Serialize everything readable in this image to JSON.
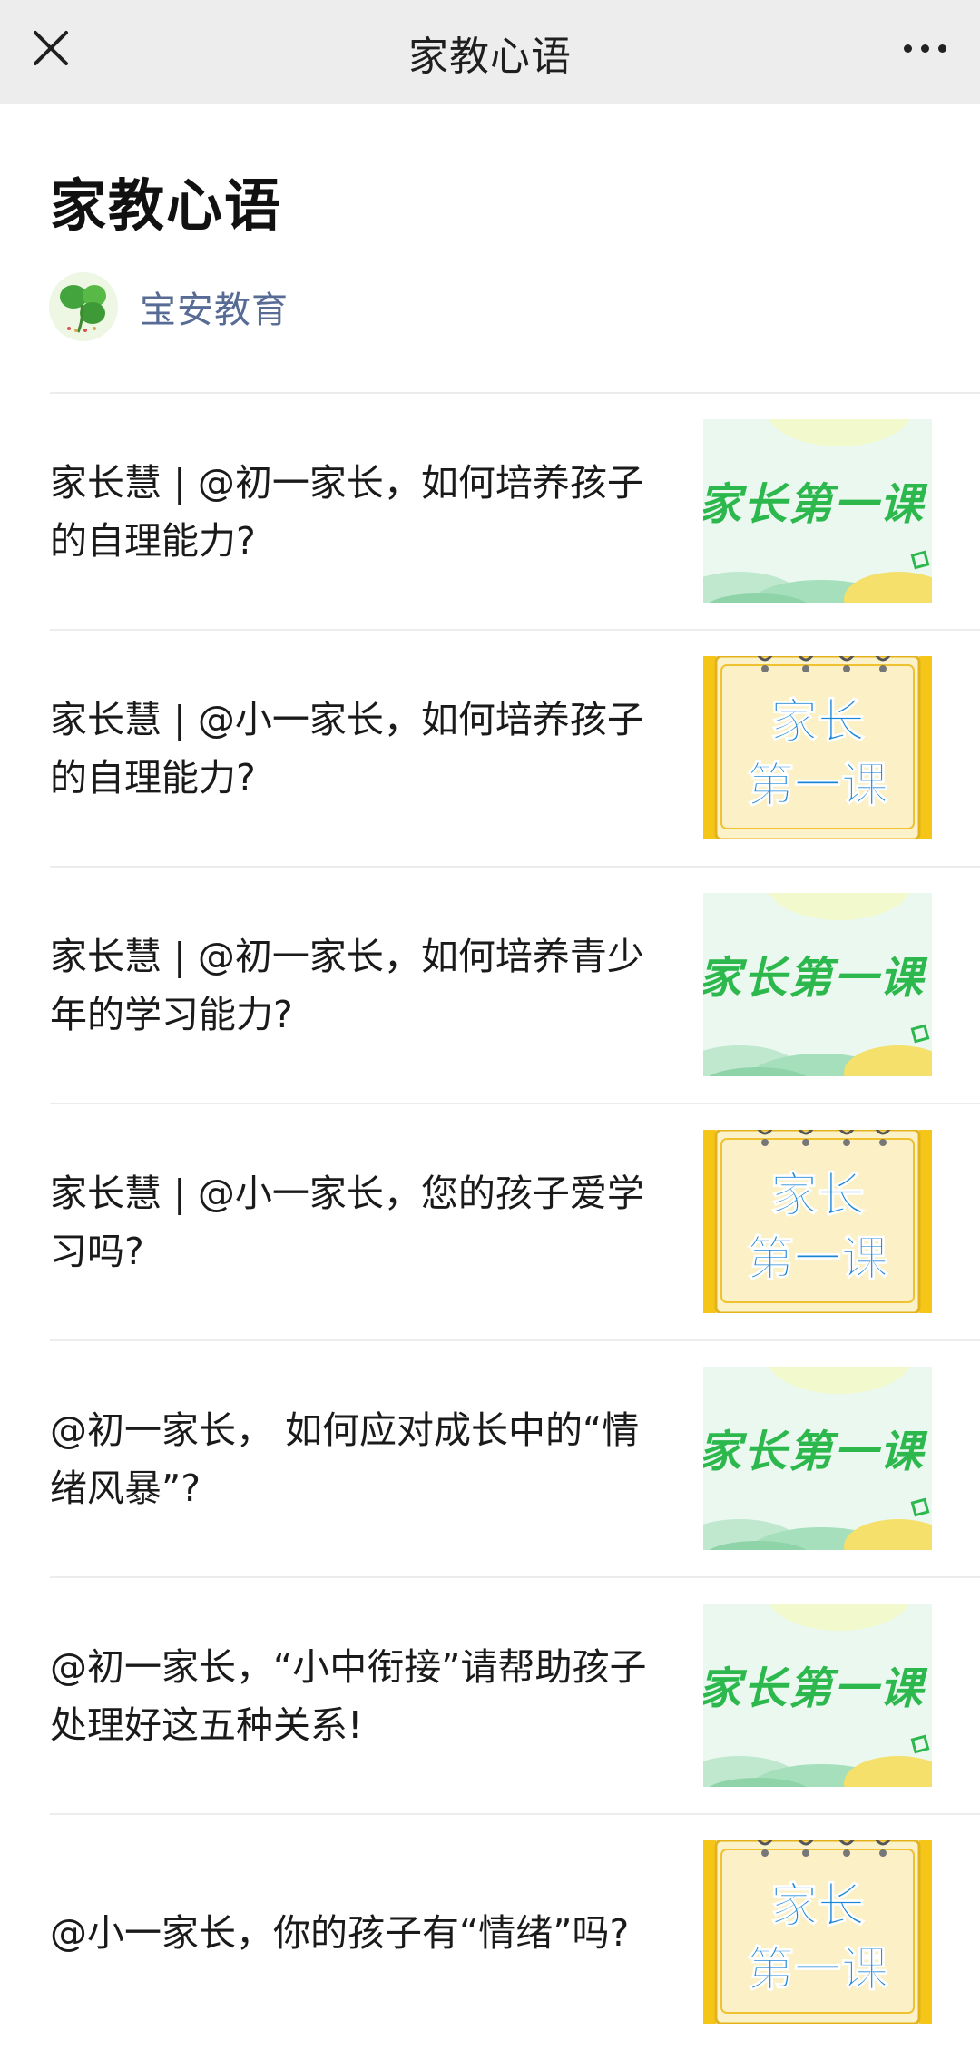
{
  "header": {
    "title": "家教心语",
    "close_icon": "close-icon",
    "more_icon": "more-icon"
  },
  "page": {
    "title": "家教心语"
  },
  "account": {
    "name": "宝安教育",
    "avatar_icon": "clover-logo-icon"
  },
  "thumbnails": {
    "green_banner_text": "家长第一课",
    "notebook_line1": "家长",
    "notebook_line2": "第一课"
  },
  "colors": {
    "topbar_bg": "#ededed",
    "account_link": "#576b95",
    "banner_green": "#2db84d",
    "notebook_blue": "#1c86d6",
    "notebook_yellow": "#f5c518"
  },
  "articles": [
    {
      "title": "家长慧 | @初一家长，如何培养孩子的自理能力?",
      "thumb": "green-banner"
    },
    {
      "title": "家长慧 | @小一家长，如何培养孩子的自理能力?",
      "thumb": "notebook"
    },
    {
      "title": "家长慧 | @初一家长，如何培养青少年的学习能力?",
      "thumb": "green-banner"
    },
    {
      "title": "家长慧 | @小一家长，您的孩子爱学习吗?",
      "thumb": "notebook"
    },
    {
      "title": "@初一家长， 如何应对成长中的“情绪风暴”?",
      "thumb": "green-banner"
    },
    {
      "title": "@初一家长，“小中衔接”请帮助孩子处理好这五种关系!",
      "thumb": "green-banner"
    },
    {
      "title": "@小一家长，你的孩子有“情绪”吗?",
      "thumb": "notebook"
    }
  ]
}
